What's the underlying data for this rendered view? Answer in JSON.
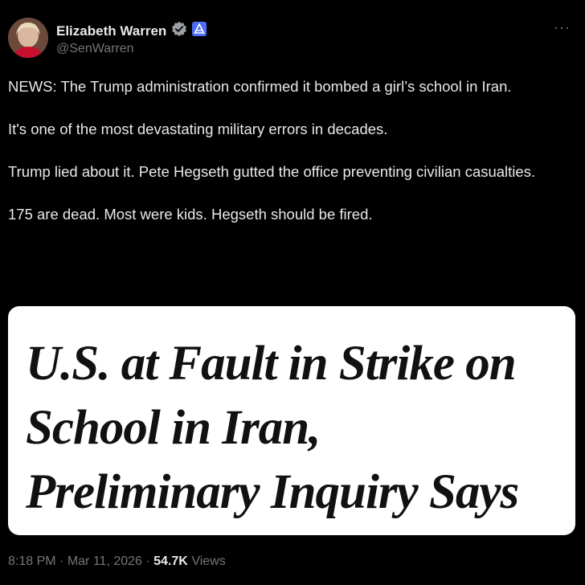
{
  "author": {
    "name": "Elizabeth Warren",
    "handle": "@SenWarren",
    "verified_badge_icon": "verified-check-icon",
    "affiliate_badge_icon": "us-senate-affiliate-icon"
  },
  "more_label": "···",
  "tweet": {
    "paragraphs": [
      "NEWS: The Trump administration confirmed it bombed a girl’s school in Iran.",
      "It's one of the most devastating military errors in decades.",
      "Trump lied about it. Pete Hegseth gutted the office preventing civilian casualties.",
      "175 are dead. Most were kids. Hegseth should be fired."
    ]
  },
  "card": {
    "headline_lines": [
      "U.S. at Fault in Strike on",
      "School in Iran,",
      "Preliminary Inquiry Says"
    ]
  },
  "meta": {
    "time": "8:18 PM",
    "separator": "·",
    "date": "Mar 11, 2026",
    "views_count": "54.7K",
    "views_label": "Views"
  },
  "colors": {
    "background": "#000000",
    "text_primary": "#e7e9ea",
    "text_secondary": "#71767b",
    "verified_blue": "#1d9bf0",
    "affiliate_blue": "#4f6cf7"
  }
}
